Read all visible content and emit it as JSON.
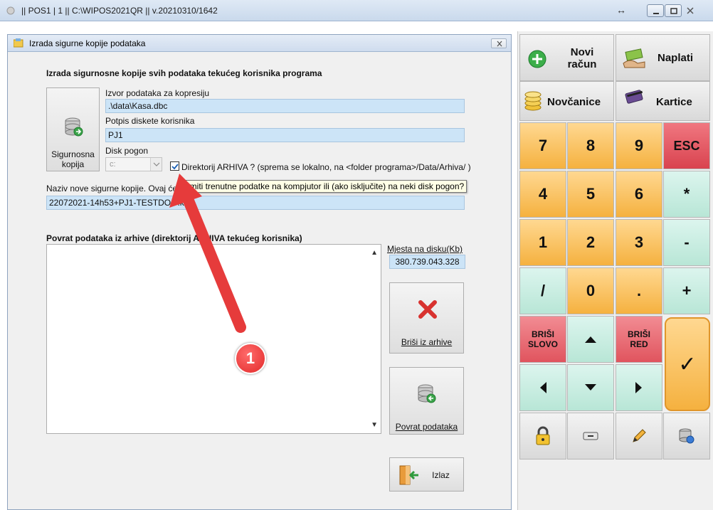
{
  "window": {
    "title": "|| POS1 | 1 || C:\\WIPOS2021QR || v.20210310/1642",
    "resize_glyph": "↔"
  },
  "dialog": {
    "title": "Izrada sigurne kopije podataka",
    "section_title": "Izrada sigurnosne kopije svih podataka tekućeg korisnika programa",
    "backup_button": "Sigurnosna kopija",
    "source_label": "Izvor podataka za kopresiju",
    "source_value": ".\\data\\Kasa.dbc",
    "signature_label": "Potpis diskete korisnika",
    "signature_value": "PJ1",
    "disk_label": "Disk pogon",
    "disk_value": "c:",
    "archive_checkbox_label": "Direktorij ARHIVA ? (sprema se lokalno, na <folder programa>/Data/Arhiva/ )",
    "archive_checked": true,
    "new_name_label": "Naziv nove sigurne kopije. Ovaj će",
    "new_name_value": "22072021-14h53+PJ1-TESTDOO.ka",
    "tooltip": "remiti trenutne podatke na kompjutor ili (ako isključite) na neki disk pogon?",
    "restore_title": "Povrat podataka iz arhive (direktorij ARHIVA tekućeg korisnika)",
    "disk_space_label": "Mjesta na disku(Kb)",
    "disk_space_value": "380.739.043.328",
    "delete_button": "Briši iz arhive",
    "restore_button": "Povrat podataka",
    "exit_button": "Izlaz",
    "callout_number": "1"
  },
  "keypad": {
    "new_bill": "Novi račun",
    "pay": "Naplati",
    "cash": "Novčanice",
    "cards": "Kartice",
    "keys": {
      "k7": "7",
      "k8": "8",
      "k9": "9",
      "esc": "ESC",
      "k4": "4",
      "k5": "5",
      "k6": "6",
      "mul": "*",
      "k1": "1",
      "k2": "2",
      "k3": "3",
      "minus": "-",
      "div": "/",
      "k0": "0",
      "dot": ".",
      "plus": "+",
      "del_char_1": "BRIŠI",
      "del_char_2": "SLOVO",
      "del_row_1": "BRIŠI",
      "del_row_2": "RED",
      "confirm": "✓"
    }
  },
  "colors": {
    "field_bg": "#cce4f7",
    "key_orange": "#f5b13f",
    "key_mint": "#b8e6d6",
    "key_red": "#d9434f",
    "callout_red": "#e22a2a"
  }
}
